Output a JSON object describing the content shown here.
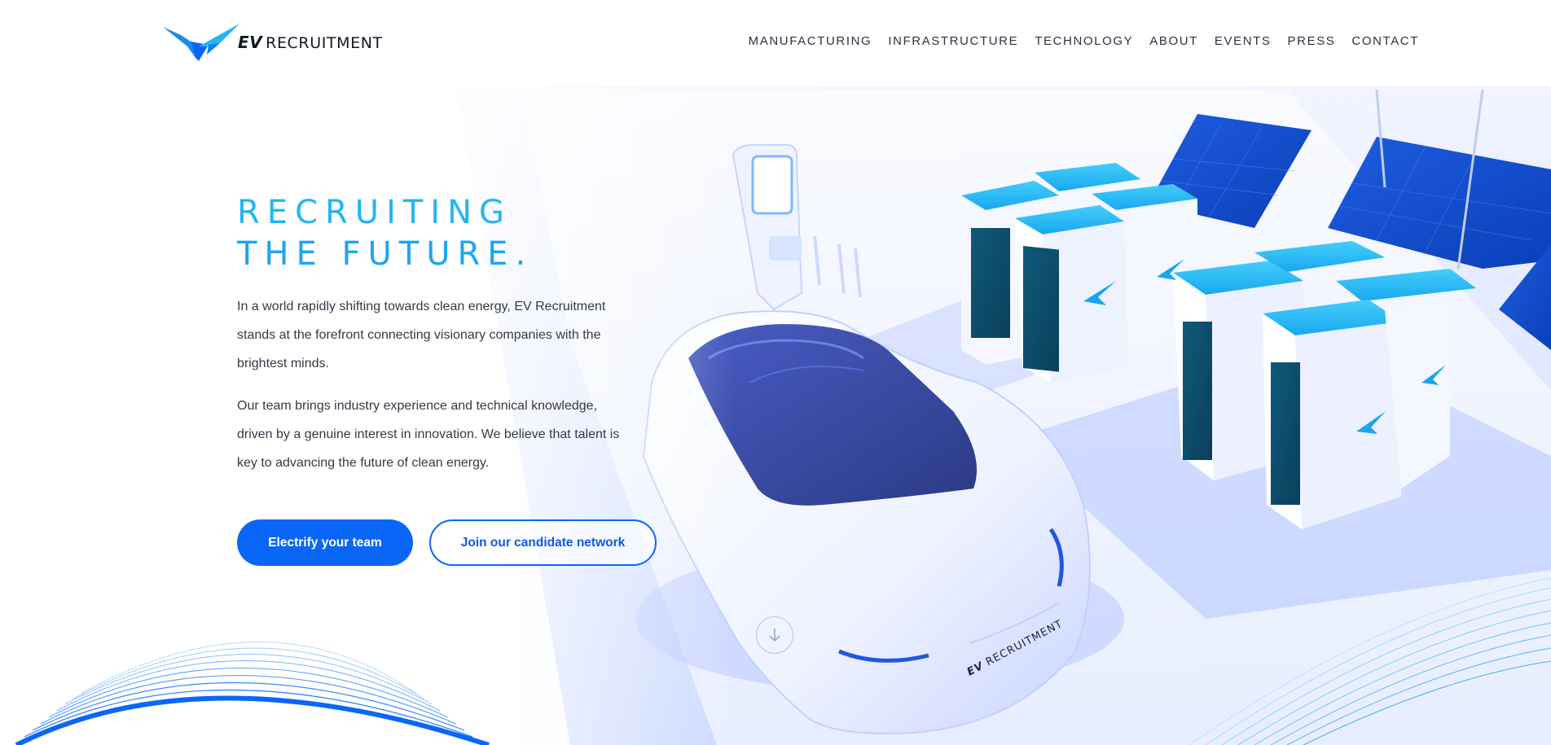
{
  "brand": {
    "logo_ev": "EV",
    "logo_word": "RECRUITMENT",
    "accent": "#0a66f6",
    "title_color": "#22b6f5"
  },
  "nav": {
    "items": [
      {
        "label": "MANUFACTURING"
      },
      {
        "label": "INFRASTRUCTURE"
      },
      {
        "label": "TECHNOLOGY"
      },
      {
        "label": "ABOUT"
      },
      {
        "label": "EVENTS"
      },
      {
        "label": "PRESS"
      },
      {
        "label": "CONTACT"
      }
    ]
  },
  "hero": {
    "title_line1": "RECRUITING",
    "title_line2": "THE FUTURE.",
    "paragraph1": "In a world rapidly shifting towards clean energy, EV Recruitment stands at the forefront connecting visionary companies with the brightest minds.",
    "paragraph2": "Our team brings industry experience and technical knowledge, driven by a genuine interest in innovation. We believe that talent is key to advancing the future of clean energy.",
    "primary_button": "Electrify your team",
    "secondary_button": "Join our candidate network"
  },
  "scene": {
    "car_badge_ev": "EV",
    "car_badge_word": "RECRUITMENT",
    "icons": [
      "eagle-logo-icon",
      "scroll-down-icon"
    ]
  }
}
